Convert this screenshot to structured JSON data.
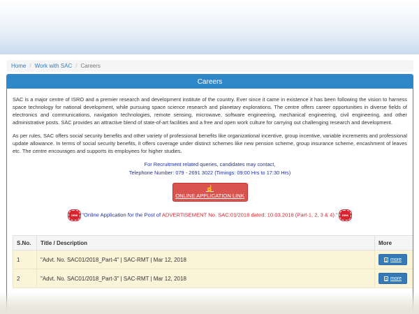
{
  "breadcrumb": {
    "home": "Home",
    "work": "Work with SAC",
    "current": "Careers",
    "sep": "/"
  },
  "panel": {
    "title": "Careers",
    "para1": "SAC is a major centre of ISRO and a premier research and development institute of the country. Ever since it came in existence it has been following the vision to harness space technology for national development, while pursuing space science research and planetary explorations. The centre offers career opportunities in diverse fields of electronics and communications, navigation technologies, remote sensing, microwave, software engineering, mechanical engineering, civil engineering, and other administrative posts. SAC provides an attractive blend of state-of-art facilities and a free and open work culture for carrying out challenging research and development.",
    "para2": "As per rules, SAC offers social security benefits and other variety of professional benefits like organizational incentive, group incentive, variable increments and professional update allowance. In terms of social security benefits, it offers coverage under distinct schemes like new pension scheme, group insurance scheme, encashment of leaves etc. The centre encourages and supports its employees for higher studies.",
    "recruit_line1": "For Recruitment related queries, candidates may contact,",
    "recruit_line2": "Telephone Number: 079 - 2691 3022 (Timings: 09:00 Hrs to 17:30 Hrs)",
    "apply_label": "ONLINE APPLICATION LINK",
    "new_badge": "new",
    "notice_part1": "\"Online Application for the Post of",
    "notice_part2": "ADVERTISEMENT No. SAC:01/2018 dated: 10.03.2018 (Part-1, 2, 3 & 4).\""
  },
  "table": {
    "headers": [
      "S.No.",
      "Title / Description",
      "More"
    ],
    "rows": [
      {
        "sno": "1",
        "title": "\"Advt. No. SAC01/2018_Part-4\" | SAC-RMT | Mar 12, 2018",
        "more": "more"
      },
      {
        "sno": "2",
        "title": "\"Advt. No. SAC01/2018_Part-3\" | SAC-RMT | Mar 12, 2018",
        "more": "more"
      }
    ]
  },
  "colors": {
    "panel_heading": "#2f86c8",
    "apply_button": "#d9534f",
    "more_button": "#337ab7",
    "row_bg": "#fbf4d9"
  }
}
